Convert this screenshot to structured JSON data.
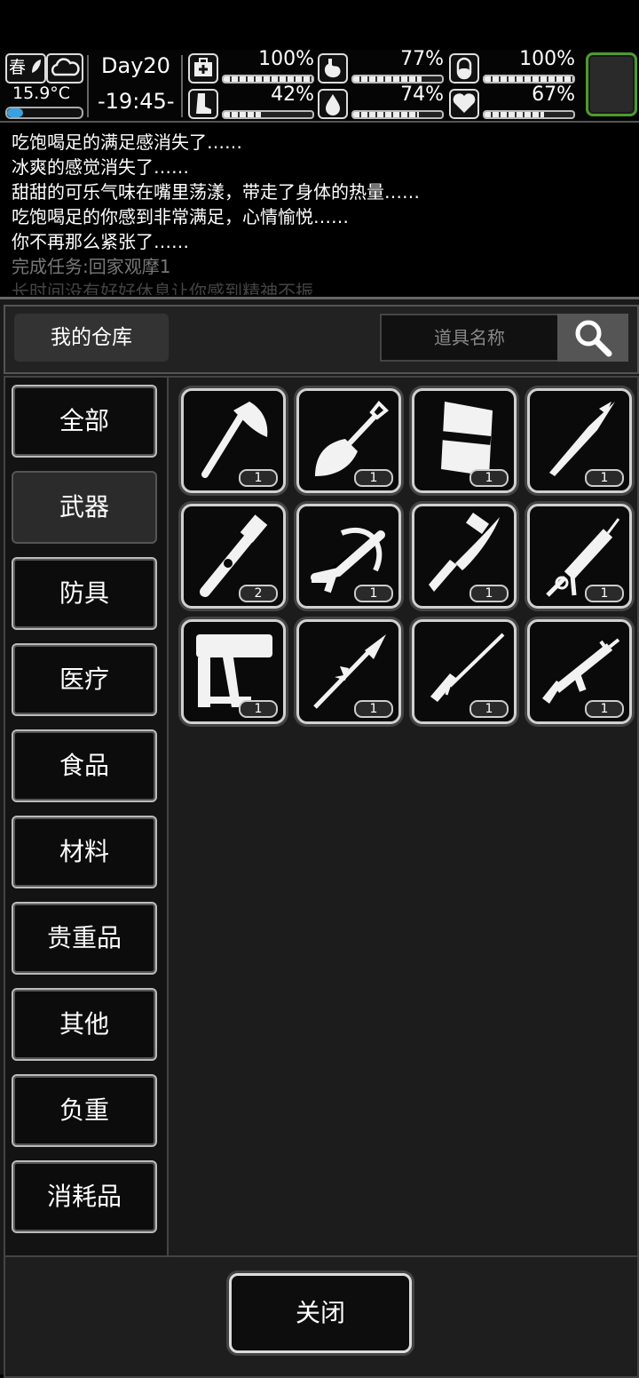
{
  "status": {
    "season": "春",
    "temperature": "15.9°C",
    "day": "Day20",
    "time": "-19:45-",
    "stats": [
      {
        "icon": "medkit-icon",
        "value": "100%",
        "level": 1.0
      },
      {
        "icon": "stomach-icon",
        "value": "77%",
        "level": 0.77
      },
      {
        "icon": "pill-icon",
        "value": "100%",
        "level": 1.0
      },
      {
        "icon": "boot-icon",
        "value": "42%",
        "level": 0.42
      },
      {
        "icon": "water-drop-icon",
        "value": "74%",
        "level": 0.74
      },
      {
        "icon": "heart-icon",
        "value": "67%",
        "level": 0.67
      }
    ]
  },
  "log": [
    "吃饱喝足的满足感消失了……",
    "冰爽的感觉消失了……",
    "甜甜的可乐气味在嘴里荡漾，带走了身体的热量……",
    "吃饱喝足的你感到非常满足，心情愉悦……",
    "你不再那么紧张了……",
    "完成任务:回家观摩1",
    "长时间没有好好休息让你感到精神不振"
  ],
  "header": {
    "title": "我的仓库",
    "search_placeholder": "道具名称"
  },
  "categories": [
    "全部",
    "武器",
    "防具",
    "医疗",
    "食品",
    "材料",
    "贵重品",
    "其他",
    "负重",
    "消耗品"
  ],
  "selected_category": "武器",
  "items": [
    {
      "icon": "axe-icon",
      "qty": "1"
    },
    {
      "icon": "shovel-icon",
      "qty": "1"
    },
    {
      "icon": "riot-shield-icon",
      "qty": "1"
    },
    {
      "icon": "spear-icon",
      "qty": "1"
    },
    {
      "icon": "pipe-wrench-icon",
      "qty": "2"
    },
    {
      "icon": "crossbow-icon",
      "qty": "1"
    },
    {
      "icon": "machete-icon",
      "qty": "1"
    },
    {
      "icon": "caulk-gun-icon",
      "qty": "1"
    },
    {
      "icon": "nail-gun-icon",
      "qty": "1"
    },
    {
      "icon": "polearm-icon",
      "qty": "1"
    },
    {
      "icon": "rifle-icon",
      "qty": "1"
    },
    {
      "icon": "submachine-gun-icon",
      "qty": "1"
    }
  ],
  "close_label": "关闭"
}
